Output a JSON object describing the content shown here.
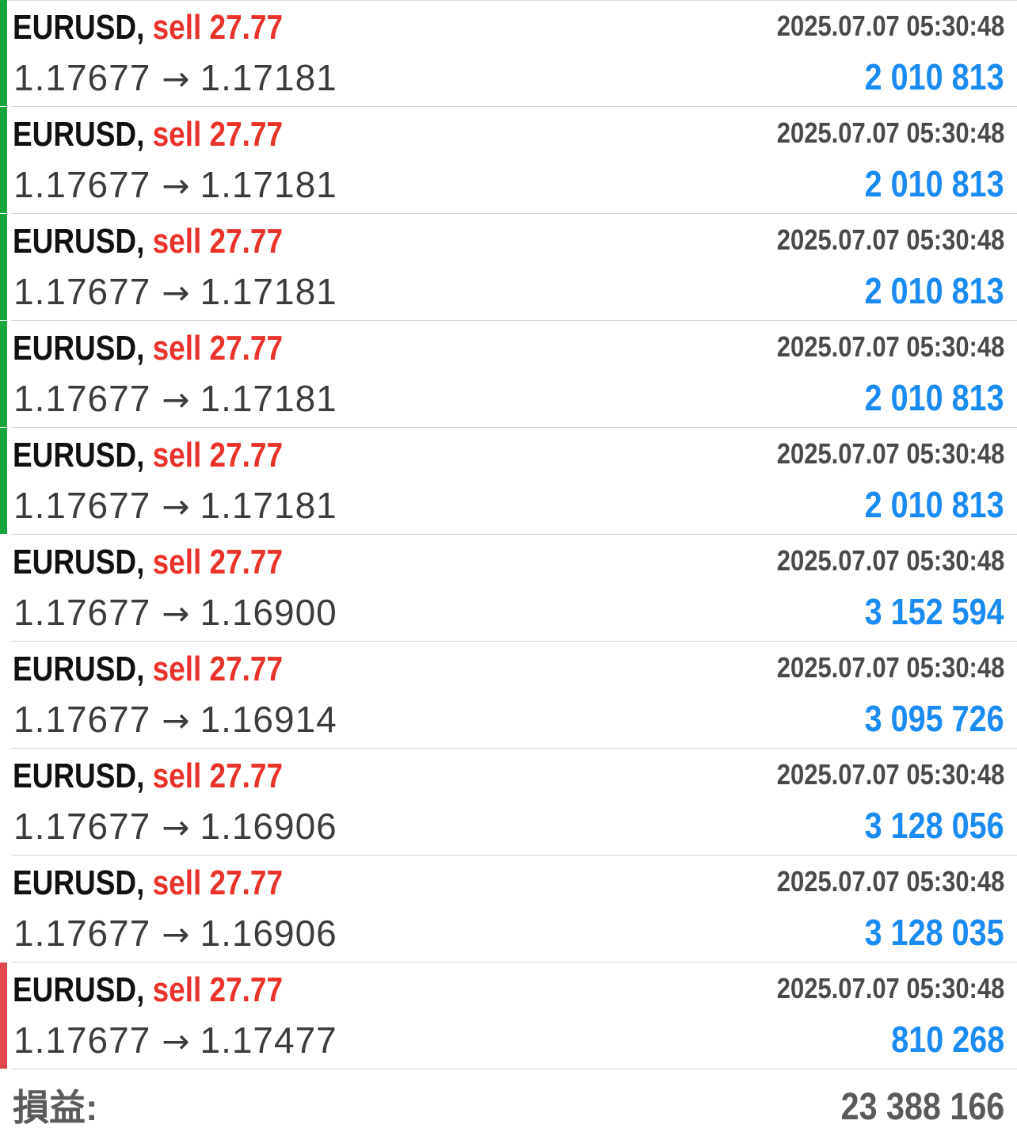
{
  "colors": {
    "sell": "#e8322a",
    "profit": "#1a8bf0",
    "indicator_green": "#1aa53a",
    "indicator_red": "#e0474c",
    "text_dark": "#111111",
    "text_gray": "#4a4a4a"
  },
  "trades": [
    {
      "symbol": "EURUSD,",
      "side": "sell",
      "volume": "27.77",
      "time": "2025.07.07 05:30:48",
      "open_price": "1.17677",
      "arrow": "→",
      "close_price": "1.17181",
      "profit": "2 010 813",
      "indicator": "green"
    },
    {
      "symbol": "EURUSD,",
      "side": "sell",
      "volume": "27.77",
      "time": "2025.07.07 05:30:48",
      "open_price": "1.17677",
      "arrow": "→",
      "close_price": "1.17181",
      "profit": "2 010 813",
      "indicator": "green"
    },
    {
      "symbol": "EURUSD,",
      "side": "sell",
      "volume": "27.77",
      "time": "2025.07.07 05:30:48",
      "open_price": "1.17677",
      "arrow": "→",
      "close_price": "1.17181",
      "profit": "2 010 813",
      "indicator": "green"
    },
    {
      "symbol": "EURUSD,",
      "side": "sell",
      "volume": "27.77",
      "time": "2025.07.07 05:30:48",
      "open_price": "1.17677",
      "arrow": "→",
      "close_price": "1.17181",
      "profit": "2 010 813",
      "indicator": "green"
    },
    {
      "symbol": "EURUSD,",
      "side": "sell",
      "volume": "27.77",
      "time": "2025.07.07 05:30:48",
      "open_price": "1.17677",
      "arrow": "→",
      "close_price": "1.17181",
      "profit": "2 010 813",
      "indicator": "green"
    },
    {
      "symbol": "EURUSD,",
      "side": "sell",
      "volume": "27.77",
      "time": "2025.07.07 05:30:48",
      "open_price": "1.17677",
      "arrow": "→",
      "close_price": "1.16900",
      "profit": "3 152 594",
      "indicator": "none"
    },
    {
      "symbol": "EURUSD,",
      "side": "sell",
      "volume": "27.77",
      "time": "2025.07.07 05:30:48",
      "open_price": "1.17677",
      "arrow": "→",
      "close_price": "1.16914",
      "profit": "3 095 726",
      "indicator": "none"
    },
    {
      "symbol": "EURUSD,",
      "side": "sell",
      "volume": "27.77",
      "time": "2025.07.07 05:30:48",
      "open_price": "1.17677",
      "arrow": "→",
      "close_price": "1.16906",
      "profit": "3 128 056",
      "indicator": "none"
    },
    {
      "symbol": "EURUSD,",
      "side": "sell",
      "volume": "27.77",
      "time": "2025.07.07 05:30:48",
      "open_price": "1.17677",
      "arrow": "→",
      "close_price": "1.16906",
      "profit": "3 128 035",
      "indicator": "none"
    },
    {
      "symbol": "EURUSD,",
      "side": "sell",
      "volume": "27.77",
      "time": "2025.07.07 05:30:48",
      "open_price": "1.17677",
      "arrow": "→",
      "close_price": "1.17477",
      "profit": "810 268",
      "indicator": "red"
    }
  ],
  "summary": {
    "label": "損益:",
    "value": "23 388 166"
  }
}
